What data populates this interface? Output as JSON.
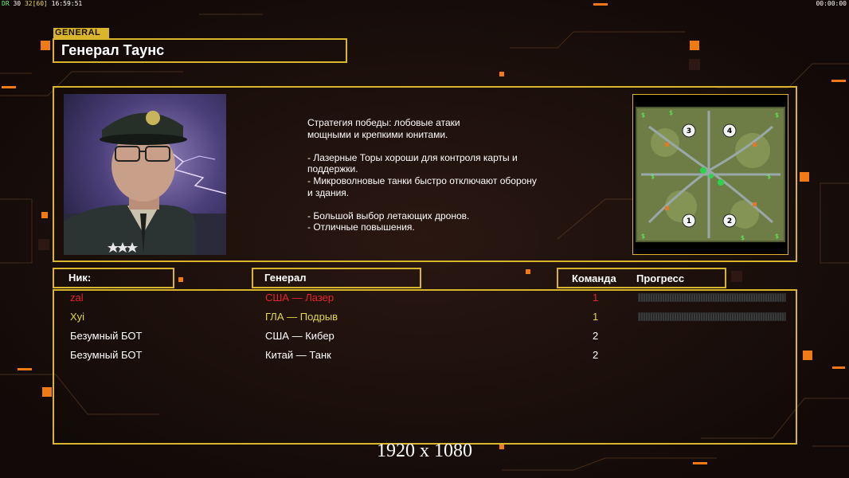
{
  "debug": {
    "a": "DR",
    "b": "30",
    "c": "32",
    "d": "[60]",
    "time": "16:59:51"
  },
  "clock": "00:00:00",
  "general": {
    "tag": "GENERAL",
    "name": "Генерал Таунс",
    "description": "Стратегия победы: лобовые атаки\nмощными и крепкими юнитами.\n\n- Лазерные Торы хороши для контроля карты и\n поддержки.\n- Микроволновые танки быстро отключают оборону\n и здания.\n\n- Большой выбор летающих дронов.\n- Отличные повышения."
  },
  "map": {
    "slots": [
      "1",
      "2",
      "3",
      "4"
    ]
  },
  "table": {
    "headers": {
      "nick": "Ник:",
      "general": "Генерал",
      "team": "Команда",
      "progress": "Прогресс"
    },
    "rows": [
      {
        "nick": "zal",
        "general": "США — Лазер",
        "team": "1",
        "progress": 0,
        "color": "#e5242a"
      },
      {
        "nick": "Xyi",
        "general": "ГЛА — Подрыв",
        "team": "1",
        "progress": 0,
        "color": "#e0d84a"
      },
      {
        "nick": "Безумный БОТ",
        "general": "США — Кибер",
        "team": "2",
        "color": "#ffffff"
      },
      {
        "nick": "Безумный БОТ",
        "general": "Китай — Танк",
        "team": "2",
        "color": "#ffffff"
      }
    ]
  },
  "resolution": "1920 x 1080",
  "colors": {
    "accent": "#d9b52e",
    "orange": "#f07a16",
    "background": "#160d0a"
  }
}
